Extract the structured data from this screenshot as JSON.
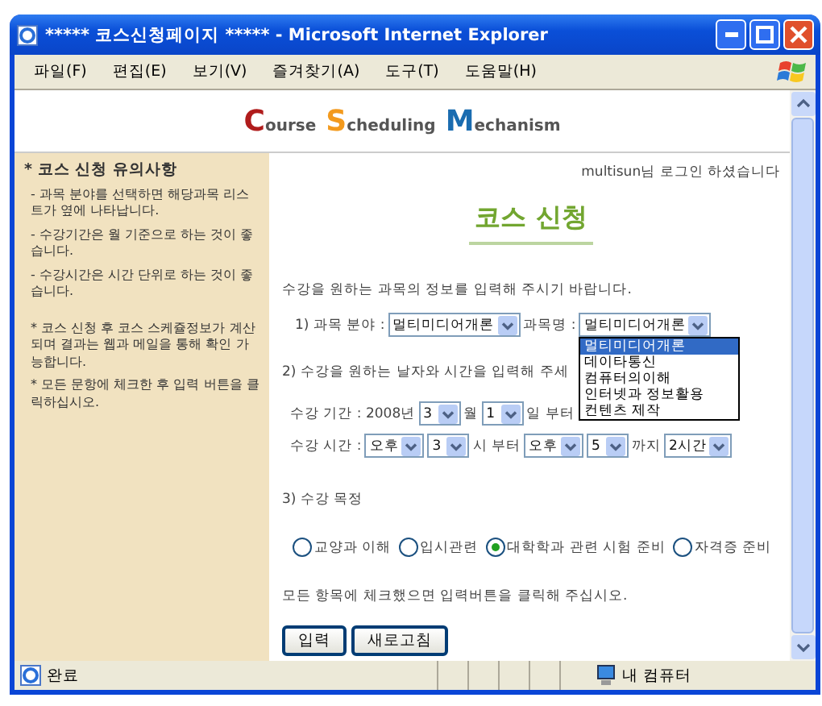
{
  "window": {
    "title": "***** 코스신청페이지 ***** - Microsoft Internet Explorer"
  },
  "menu": [
    "파일(F)",
    "편집(E)",
    "보기(V)",
    "즐겨찾기(A)",
    "도구(T)",
    "도움말(H)"
  ],
  "logo": [
    {
      "initial": "C",
      "rest": "ourse",
      "color": "#b01c1c"
    },
    {
      "initial": "S",
      "rest": "cheduling",
      "color": "#f39a1e"
    },
    {
      "initial": "M",
      "rest": "echanism",
      "color": "#1a6cb0"
    }
  ],
  "sidebar": {
    "heading": "* 코스 신청 유의사항",
    "notes": [
      {
        "kind": "dash",
        "text": "- 과목 분야를 선택하면 해당과목 리스트가 옆에 나타납니다."
      },
      {
        "kind": "dash",
        "text": "- 수강기간은 월 기준으로 하는 것이 좋습니다."
      },
      {
        "kind": "dash",
        "text": "- 수강시간은 시간 단위로 하는 것이 좋습니다."
      },
      {
        "kind": "star",
        "text": "* 코스 신청 후 코스 스케쥴정보가 계산되며 결과는 웹과 메일을 통해 확인 가능합니다."
      },
      {
        "kind": "star",
        "text": "* 모든 문항에 체크한 후 입력 버튼을 클릭하십시오."
      }
    ]
  },
  "main": {
    "login_notice": "multisun님 로그인 하셨습니다",
    "heading": "코스 신청",
    "instruction": "수강을 원하는 과목의 정보를 입력해 주시기 바랍니다.",
    "step1": [
      {
        "kind": "text",
        "text": "1) 과목 분야 :"
      },
      {
        "kind": "select",
        "value": "멀티미디어개론"
      },
      {
        "kind": "text",
        "text": "과목명 :"
      },
      {
        "kind": "select",
        "value": "멀티미디어개론",
        "options": [
          {
            "label": "멀티미디어개론",
            "selected": true
          },
          {
            "label": "데이타통신",
            "selected": false
          },
          {
            "label": "컴퓨터의이해",
            "selected": false
          },
          {
            "label": "인터넷과 정보활용",
            "selected": false
          },
          {
            "label": "컨텐츠 제작",
            "selected": false
          }
        ]
      }
    ],
    "step2_label": "2) 수강을 원하는 날자와 시간을 입력해 주세",
    "period": [
      {
        "kind": "text",
        "text": "수강 기간 : 2008년"
      },
      {
        "kind": "select",
        "value": "3"
      },
      {
        "kind": "text",
        "text": "월"
      },
      {
        "kind": "select",
        "value": "1"
      },
      {
        "kind": "text",
        "text": "일 부터"
      }
    ],
    "time": [
      {
        "kind": "text",
        "text": "수강 시간 :"
      },
      {
        "kind": "select",
        "value": "오후"
      },
      {
        "kind": "select",
        "value": "3"
      },
      {
        "kind": "text",
        "text": "시 부터"
      },
      {
        "kind": "select",
        "value": "오후"
      },
      {
        "kind": "select",
        "value": "5"
      },
      {
        "kind": "text",
        "text": "까지"
      },
      {
        "kind": "select",
        "value": "2시간"
      }
    ],
    "step3_label": "3) 수강 목정",
    "purposes": [
      {
        "label": "교양과 이해",
        "selected": false
      },
      {
        "label": "입시관련",
        "selected": false
      },
      {
        "label": "대학학과 관련 시험 준비",
        "selected": true
      },
      {
        "label": "자격증 준비",
        "selected": false
      }
    ],
    "message": "모든 항목에 체크했으면 입력버튼을 클릭해 주십시오.",
    "buttons": [
      "입력",
      "새로고침"
    ]
  },
  "status_bar": {
    "text": "완료",
    "zone": "내 컴퓨터"
  }
}
